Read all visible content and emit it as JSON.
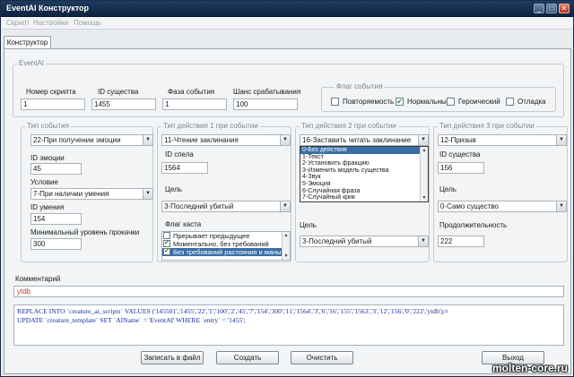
{
  "window": {
    "title": "EventAI Конструктор"
  },
  "menu": [
    "Скрипт",
    "Настройки",
    "Помощь"
  ],
  "tab": "Конструктор",
  "eventai": {
    "group_label": "EventAI",
    "script_no_label": "Номер скрипта",
    "script_no": "1",
    "creature_id_label": "ID существа",
    "creature_id": "1455",
    "phase_label": "Фаза события",
    "phase": "1",
    "chance_label": "Шанс срабатывания",
    "chance": "100",
    "flags_label": "Флаг события",
    "flags": [
      {
        "label": "Повторяемость",
        "checked": false
      },
      {
        "label": "Нормальный",
        "checked": true
      },
      {
        "label": "Героический",
        "checked": false
      },
      {
        "label": "Отладка",
        "checked": false
      }
    ]
  },
  "event": {
    "group_label": "Тип события",
    "type": "22-При получении эмоции",
    "emote_id_label": "ID эмоции",
    "emote_id": "45",
    "condition_label": "Условие",
    "condition": "7-При наличии умения",
    "skill_id_label": "ID умения",
    "skill_id": "154",
    "min_skill_label": "Минимальный уровень прокачки",
    "min_skill": "300"
  },
  "action1": {
    "group_label": "Тип действия 1 при событии",
    "type": "11-Чтение заклинания",
    "spell_id_label": "ID спела",
    "spell_id": "1564",
    "target_label": "Цель",
    "target": "3-Последний убитый",
    "cast_flags_label": "Флаг каста",
    "cast_flags": [
      {
        "label": "Прерывает предыдущее",
        "checked": false
      },
      {
        "label": "Моментально, без требований",
        "checked": true
      },
      {
        "label": "Без требований растояния и маны",
        "checked": true
      }
    ]
  },
  "action2": {
    "group_label": "Тип действия 2 при событии",
    "type": "16-Заставить читать заклинание",
    "options": [
      "0-Без действия",
      "1-Текст",
      "2-Установить фракцию",
      "3-Изменить модель существа",
      "4-Звук",
      "5-Эмоция",
      "6-Случайная фраза",
      "7-Случайный крик"
    ],
    "target_label": "Цель",
    "target": "3-Последний убитый"
  },
  "action3": {
    "group_label": "Тип действия 3 при событии",
    "type": "12-Призыв",
    "creature_id_label": "ID существа",
    "creature_id": "156",
    "target_label": "Цель",
    "target": "0-Само существо",
    "duration_label": "Продолжительность",
    "duration": "222"
  },
  "comment": {
    "label": "Комментарий",
    "value": "ytdb"
  },
  "sql": {
    "lines": [
      "REPLACE INTO `creature_ai_scripts` VALUES ('145501','1455','22','1','100','2','45','7','154','300','11','1564','3','6','16','155','1563','3','12','156','0','222','ytdb');¤",
      "UPDATE `creature_template` SET `AIName` = 'EventAI' WHERE `entry` = '1455';"
    ]
  },
  "buttons": {
    "save_file": "Записать в файл",
    "create": "Создать",
    "clear": "Очистить",
    "exit": "Выход"
  },
  "watermark": "molten-core.ru"
}
